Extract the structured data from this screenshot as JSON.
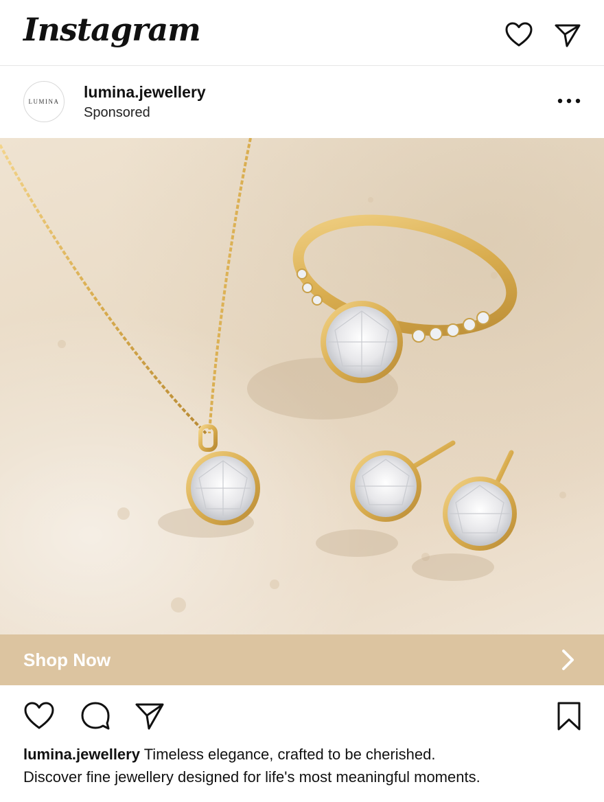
{
  "app": {
    "logo_text": "Instagram"
  },
  "header_icons": {
    "activity": "heart-icon",
    "direct": "send-icon"
  },
  "post": {
    "avatar_text": "LUMINA",
    "username": "lumina.jewellery",
    "sponsored_label": "Sponsored",
    "more_icon": "more-dots-icon",
    "image_alt": "Gold necklace with round diamond pendant, diamond engagement ring and diamond stud earrings on cream stone"
  },
  "cta": {
    "label": "Shop Now",
    "icon": "chevron-right-icon",
    "color": "#dcc4a0"
  },
  "actions": {
    "like": "heart-icon",
    "comment": "comment-icon",
    "share": "send-icon",
    "save": "bookmark-icon"
  },
  "caption": {
    "username": "lumina.jewellery",
    "line1": "Timeless elegance, crafted to be cherished.",
    "line2": "Discover fine jewellery designed for life's most meaningful moments."
  },
  "colors": {
    "gold": "#d9ad4f",
    "stone": "#eadbc7",
    "text": "#111111"
  }
}
